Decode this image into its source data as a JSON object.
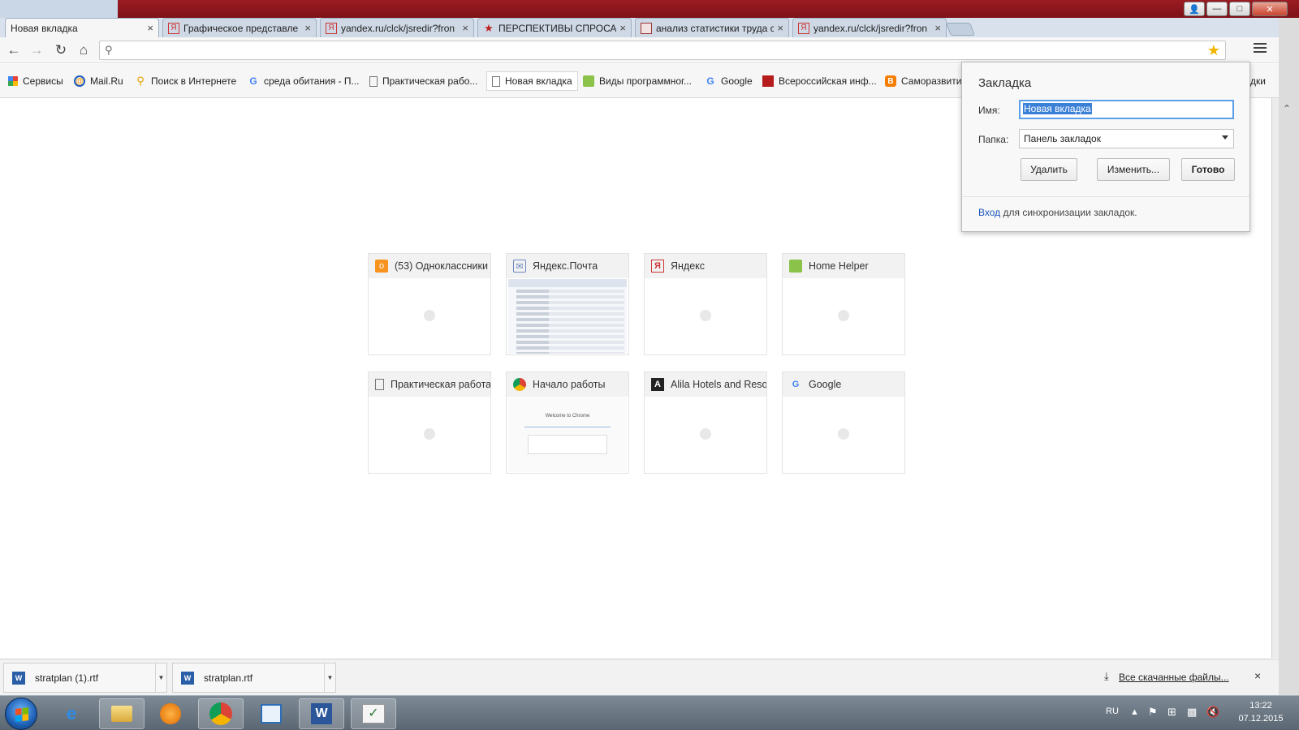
{
  "window": {
    "tabs": [
      {
        "title": "Новая вкладка",
        "active": true
      },
      {
        "title": "Графическое представле",
        "active": false
      },
      {
        "title": "yandex.ru/clck/jsredir?fron",
        "active": false
      },
      {
        "title": "ПЕРСПЕКТИВЫ СПРОСА Н",
        "active": false
      },
      {
        "title": "анализ статистики труда с",
        "active": false
      },
      {
        "title": "yandex.ru/clck/jsredir?fron",
        "active": false
      }
    ],
    "tab_close": "×"
  },
  "toolbar": {
    "omnibox_value": "",
    "icons": [
      "back-icon",
      "forward-icon",
      "reload-icon",
      "home-icon",
      "search-icon",
      "star-icon",
      "menu-icon"
    ]
  },
  "bookmarks": [
    {
      "label": "Сервисы",
      "icon": "apps-icon"
    },
    {
      "label": "Mail.Ru",
      "icon": "mailru-icon"
    },
    {
      "label": "Поиск в Интернете",
      "icon": "search-icon"
    },
    {
      "label": "среда обитания - П...",
      "icon": "google-icon"
    },
    {
      "label": "Практическая рабо...",
      "icon": "page-icon"
    },
    {
      "label": "Новая вкладка",
      "icon": "page-icon"
    },
    {
      "label": "Виды программног...",
      "icon": "android-icon"
    },
    {
      "label": "Google",
      "icon": "google-icon"
    },
    {
      "label": "Всероссийская инф...",
      "icon": "site-icon"
    },
    {
      "label": "Саморазвити",
      "icon": "blogger-icon"
    },
    {
      "label": "дки",
      "icon": ""
    }
  ],
  "bookmark_popup": {
    "title": "Закладка",
    "name_label": "Имя:",
    "name_value": "Новая вкладка",
    "folder_label": "Папка:",
    "folder_value": "Панель закладок",
    "delete_btn": "Удалить",
    "edit_btn": "Изменить...",
    "done_btn": "Готово",
    "sync_link": "Вход",
    "sync_text": " для синхронизации закладок."
  },
  "tiles": [
    {
      "title": "(53) Одноклассники",
      "icon": "odnoklassniki-icon",
      "thumb": "blank"
    },
    {
      "title": "Яндекс.Почта",
      "icon": "mail-icon",
      "thumb": "mail"
    },
    {
      "title": "Яндекс",
      "icon": "yandex-icon",
      "thumb": "blank"
    },
    {
      "title": "Home Helper",
      "icon": "android-icon",
      "thumb": "blank"
    },
    {
      "title": "Практическая работа",
      "icon": "page-icon",
      "thumb": "blank"
    },
    {
      "title": "Начало работы",
      "icon": "chrome-icon",
      "thumb": "chrome"
    },
    {
      "title": "Alila Hotels and Reso",
      "icon": "alila-icon",
      "thumb": "blank"
    },
    {
      "title": "Google",
      "icon": "google-icon",
      "thumb": "blank"
    }
  ],
  "thumb_chrome_text": "Welcome to Chrome",
  "downloads": {
    "items": [
      "stratplan (1).rtf",
      "stratplan.rtf"
    ],
    "show_all": "Все скачанные файлы...",
    "close": "×"
  },
  "taskbar": {
    "lang": "RU",
    "time": "13:22",
    "date": "07.12.2015",
    "apps": [
      "ie-icon",
      "explorer-icon",
      "media-player-icon",
      "chrome-icon",
      "app-icon",
      "word-icon",
      "checklist-icon"
    ]
  },
  "colors": {
    "tab_strip": "#d8e1ec",
    "accent_blue": "#3b80d7",
    "title_bar_red": "#9a1c22"
  }
}
